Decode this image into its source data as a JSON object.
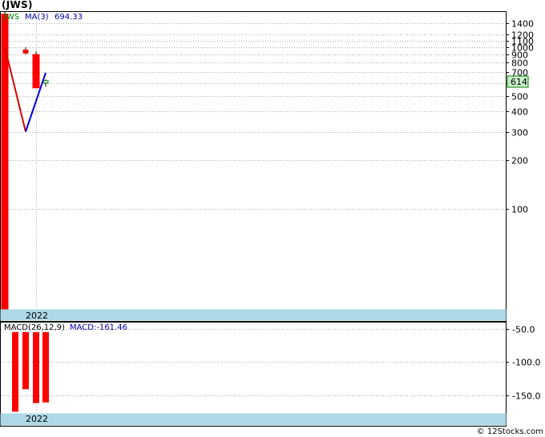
{
  "title": "(JWS)",
  "footer": "© 12Stocks.com",
  "colors": {
    "up": "#ffffff",
    "down": "#ff0000",
    "ma_down": "#dd0000",
    "ma_up": "#0000dd",
    "ticker_text": "#008000",
    "ma_text": "#0000aa",
    "axis_band": "#add8e6",
    "current_box": "#c9f0c9",
    "grid": "#b0b0b0"
  },
  "chart_data": [
    {
      "type": "candlestick",
      "legend": {
        "ticker": "JWS",
        "ma_label": "MA(3)",
        "ma_value": "694.33"
      },
      "scale": "log",
      "ylim": [
        24,
        1650
      ],
      "y_ticks": [
        "1400",
        "1200",
        "1100",
        "1000",
        "900",
        "800",
        "700",
        "600",
        "500",
        "400",
        "300",
        "200",
        "100"
      ],
      "y_tick_values": [
        1400,
        1200,
        1100,
        1000,
        900,
        800,
        700,
        600,
        500,
        400,
        300,
        200,
        100
      ],
      "current_price_label": "614",
      "current_price": 614,
      "x_label": "2022",
      "candles": [
        {
          "open": 1600,
          "high": 1650,
          "low": 24,
          "close": 24,
          "dir": "down"
        },
        {
          "open": 960,
          "high": 1000,
          "low": 900,
          "close": 920,
          "dir": "down"
        },
        {
          "open": 900,
          "high": 940,
          "low": 560,
          "close": 560,
          "dir": "down"
        },
        {
          "open": 600,
          "high": 630,
          "low": 570,
          "close": 620,
          "dir": "up"
        }
      ],
      "moving_average": [
        {
          "candle": 0,
          "value": 1000
        },
        {
          "candle": 1,
          "value": 300
        },
        {
          "candle": 3,
          "value": 694
        }
      ]
    },
    {
      "type": "bar",
      "legend": {
        "label": "MACD(26,12,9)",
        "value_label": "MACD:-161.46"
      },
      "ylim": [
        -177,
        -40
      ],
      "y_ticks": [
        "-50.0",
        "-100.0",
        "-150.0"
      ],
      "y_tick_values": [
        -50,
        -100,
        -150
      ],
      "x_label": "2022",
      "values": [
        -175,
        -141,
        -162,
        -161
      ]
    }
  ]
}
